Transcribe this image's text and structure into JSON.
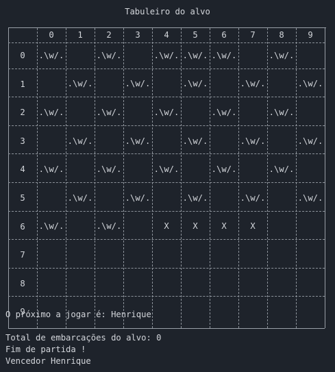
{
  "board": {
    "title": "Tabuleiro do alvo",
    "columns": [
      "0",
      "1",
      "2",
      "3",
      "4",
      "5",
      "6",
      "7",
      "8",
      "9"
    ],
    "rows": [
      {
        "label": "0",
        "cells": [
          ".\\w/.",
          "",
          ".\\w/.",
          "",
          ".\\w/.",
          ".\\w/.",
          ".\\w/.",
          "",
          ".\\w/.",
          ""
        ]
      },
      {
        "label": "1",
        "cells": [
          "",
          ".\\w/.",
          "",
          ".\\w/.",
          "",
          ".\\w/.",
          "",
          ".\\w/.",
          "",
          ".\\w/."
        ]
      },
      {
        "label": "2",
        "cells": [
          ".\\w/.",
          "",
          ".\\w/.",
          "",
          ".\\w/.",
          "",
          ".\\w/.",
          "",
          ".\\w/.",
          ""
        ]
      },
      {
        "label": "3",
        "cells": [
          "",
          ".\\w/.",
          "",
          ".\\w/.",
          "",
          ".\\w/.",
          "",
          ".\\w/.",
          "",
          ".\\w/."
        ]
      },
      {
        "label": "4",
        "cells": [
          ".\\w/.",
          "",
          ".\\w/.",
          "",
          ".\\w/.",
          "",
          ".\\w/.",
          "",
          ".\\w/.",
          ""
        ]
      },
      {
        "label": "5",
        "cells": [
          "",
          ".\\w/.",
          "",
          ".\\w/.",
          "",
          ".\\w/.",
          "",
          ".\\w/.",
          "",
          ".\\w/."
        ]
      },
      {
        "label": "6",
        "cells": [
          ".\\w/.",
          "",
          ".\\w/.",
          "",
          "X",
          "X",
          "X",
          "X",
          "",
          ""
        ]
      },
      {
        "label": "7",
        "cells": [
          "",
          "",
          "",
          "",
          "",
          "",
          "",
          "",
          "",
          ""
        ]
      },
      {
        "label": "8",
        "cells": [
          "",
          "",
          "",
          "",
          "",
          "",
          "",
          "",
          "",
          ""
        ]
      },
      {
        "label": "9",
        "cells": [
          "",
          "",
          "",
          "",
          "",
          "",
          "",
          "",
          "",
          ""
        ]
      }
    ]
  },
  "status": {
    "next_player": "O próximo a jogar é: Henrique",
    "total_ships": "Total de embarcações do alvo: 0",
    "game_over": "Fim de partida !",
    "winner": "Vencedor Henrique"
  }
}
